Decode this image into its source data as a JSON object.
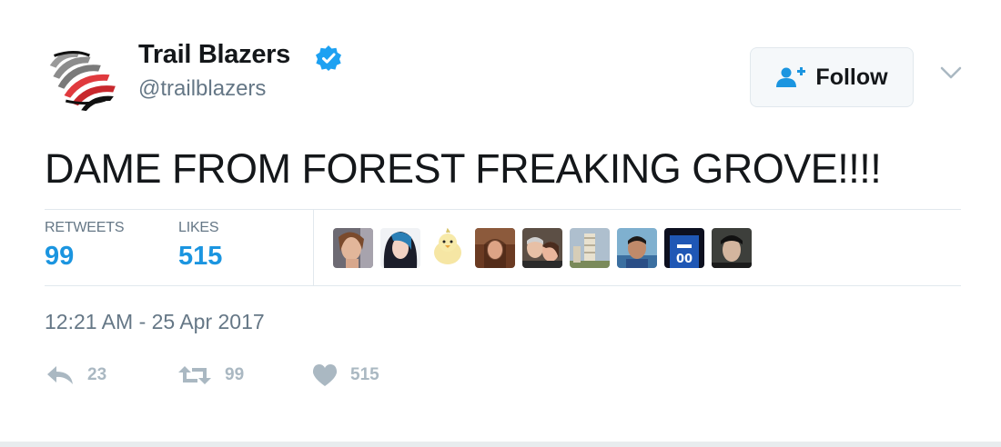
{
  "user": {
    "name": "Trail Blazers",
    "handle": "@trailblazers",
    "verified": true,
    "avatar_icon": "trail-blazers-logo-icon"
  },
  "follow_button": {
    "label": "Follow",
    "icon": "add-user-icon"
  },
  "tweet": {
    "text": "DAME FROM FOREST FREAKING GROVE!!!!"
  },
  "stats": {
    "retweets_label": "RETWEETS",
    "retweets_value": "99",
    "likes_label": "LIKES",
    "likes_value": "515"
  },
  "likers_count_shown": 9,
  "timestamp": "12:21 AM - 25 Apr 2017",
  "actions": {
    "reply_count": "23",
    "retweet_count": "99",
    "like_count": "515"
  },
  "colors": {
    "accent": "#1b95e0",
    "verified": "#1da1f2",
    "muted": "#657786",
    "action_gray": "#aab8c2",
    "logo_red": "#e03a3e"
  }
}
